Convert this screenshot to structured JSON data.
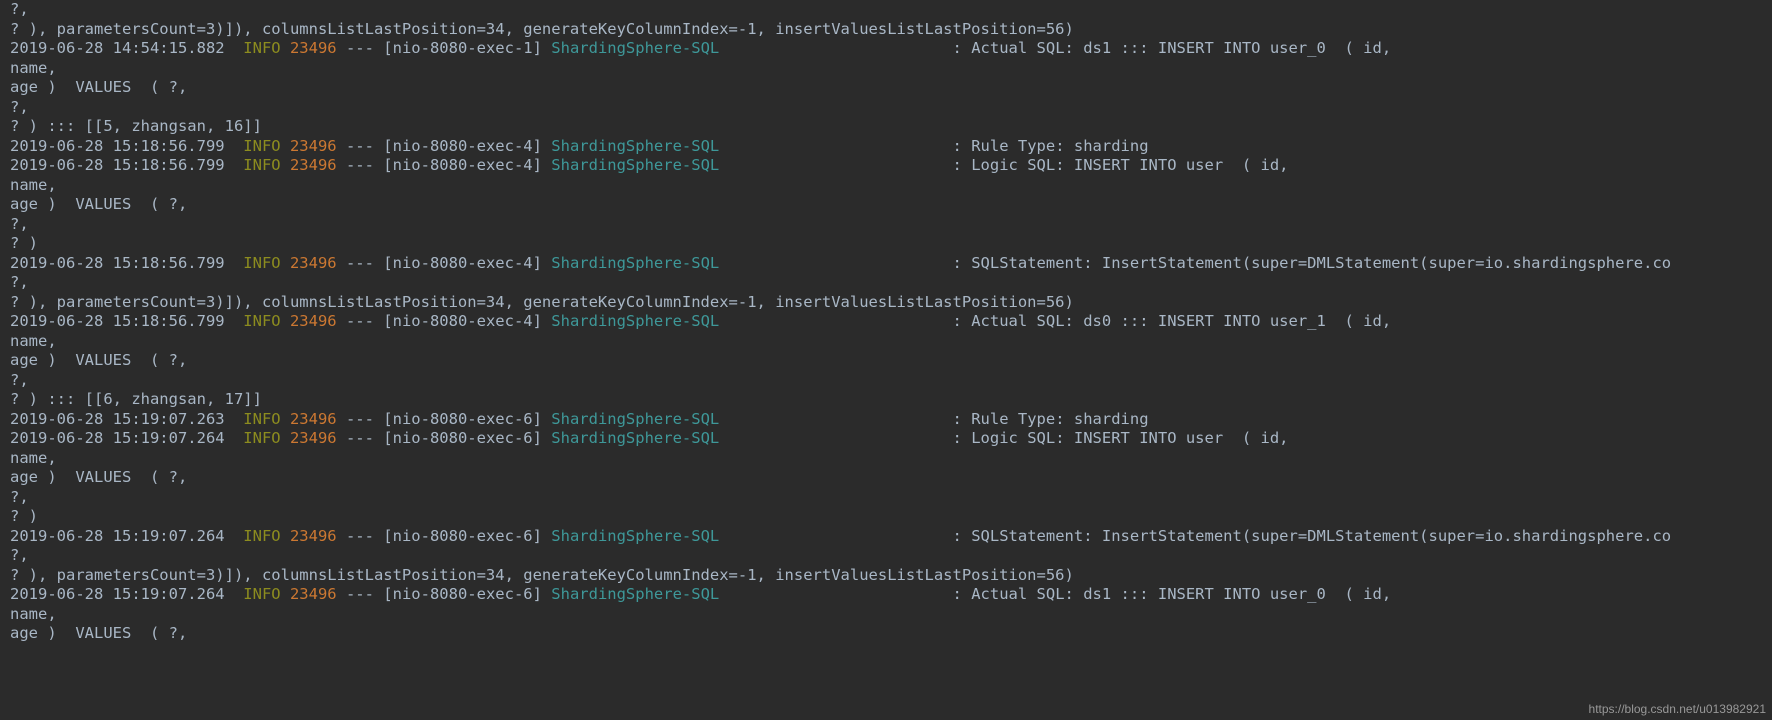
{
  "colors": {
    "bg": "#2b2b2b",
    "text": "#a9b7c6",
    "level": "#8c8c1f",
    "pid": "#cc7832",
    "logger": "#3e9899"
  },
  "watermark": "https://blog.csdn.net/u013982921",
  "lines": [
    {
      "segments": [
        {
          "t": "text",
          "v": "?,"
        }
      ]
    },
    {
      "segments": [
        {
          "t": "text",
          "v": "? ), parametersCount=3)]), columnsListLastPosition=34, generateKeyColumnIndex=-1, insertValuesListLastPosition=56)"
        }
      ]
    },
    {
      "segments": [
        {
          "t": "text",
          "v": "2019-06-28 14:54:15.882  "
        },
        {
          "t": "info",
          "v": "INFO"
        },
        {
          "t": "text",
          "v": " "
        },
        {
          "t": "pid",
          "v": "23496"
        },
        {
          "t": "text",
          "v": " --- [nio-8080-exec-1] "
        },
        {
          "t": "logger",
          "v": "ShardingSphere-SQL"
        },
        {
          "t": "text",
          "v": "                         : Actual SQL: ds1 ::: INSERT INTO user_0  ( id,"
        }
      ]
    },
    {
      "segments": [
        {
          "t": "text",
          "v": "name,"
        }
      ]
    },
    {
      "segments": [
        {
          "t": "text",
          "v": "age )  VALUES  ( ?,"
        }
      ]
    },
    {
      "segments": [
        {
          "t": "text",
          "v": "?,"
        }
      ]
    },
    {
      "segments": [
        {
          "t": "text",
          "v": "? ) ::: [[5, zhangsan, 16]]"
        }
      ]
    },
    {
      "segments": [
        {
          "t": "text",
          "v": "2019-06-28 15:18:56.799  "
        },
        {
          "t": "info",
          "v": "INFO"
        },
        {
          "t": "text",
          "v": " "
        },
        {
          "t": "pid",
          "v": "23496"
        },
        {
          "t": "text",
          "v": " --- [nio-8080-exec-4] "
        },
        {
          "t": "logger",
          "v": "ShardingSphere-SQL"
        },
        {
          "t": "text",
          "v": "                         : Rule Type: sharding"
        }
      ]
    },
    {
      "segments": [
        {
          "t": "text",
          "v": "2019-06-28 15:18:56.799  "
        },
        {
          "t": "info",
          "v": "INFO"
        },
        {
          "t": "text",
          "v": " "
        },
        {
          "t": "pid",
          "v": "23496"
        },
        {
          "t": "text",
          "v": " --- [nio-8080-exec-4] "
        },
        {
          "t": "logger",
          "v": "ShardingSphere-SQL"
        },
        {
          "t": "text",
          "v": "                         : Logic SQL: INSERT INTO user  ( id,"
        }
      ]
    },
    {
      "segments": [
        {
          "t": "text",
          "v": "name,"
        }
      ]
    },
    {
      "segments": [
        {
          "t": "text",
          "v": "age )  VALUES  ( ?,"
        }
      ]
    },
    {
      "segments": [
        {
          "t": "text",
          "v": "?,"
        }
      ]
    },
    {
      "segments": [
        {
          "t": "text",
          "v": "? )"
        }
      ]
    },
    {
      "segments": [
        {
          "t": "text",
          "v": "2019-06-28 15:18:56.799  "
        },
        {
          "t": "info",
          "v": "INFO"
        },
        {
          "t": "text",
          "v": " "
        },
        {
          "t": "pid",
          "v": "23496"
        },
        {
          "t": "text",
          "v": " --- [nio-8080-exec-4] "
        },
        {
          "t": "logger",
          "v": "ShardingSphere-SQL"
        },
        {
          "t": "text",
          "v": "                         : SQLStatement: InsertStatement(super=DMLStatement(super=io.shardingsphere.co"
        }
      ]
    },
    {
      "segments": [
        {
          "t": "text",
          "v": "?,"
        }
      ]
    },
    {
      "segments": [
        {
          "t": "text",
          "v": "? ), parametersCount=3)]), columnsListLastPosition=34, generateKeyColumnIndex=-1, insertValuesListLastPosition=56)"
        }
      ]
    },
    {
      "segments": [
        {
          "t": "text",
          "v": "2019-06-28 15:18:56.799  "
        },
        {
          "t": "info",
          "v": "INFO"
        },
        {
          "t": "text",
          "v": " "
        },
        {
          "t": "pid",
          "v": "23496"
        },
        {
          "t": "text",
          "v": " --- [nio-8080-exec-4] "
        },
        {
          "t": "logger",
          "v": "ShardingSphere-SQL"
        },
        {
          "t": "text",
          "v": "                         : Actual SQL: ds0 ::: INSERT INTO user_1  ( id,"
        }
      ]
    },
    {
      "segments": [
        {
          "t": "text",
          "v": "name,"
        }
      ]
    },
    {
      "segments": [
        {
          "t": "text",
          "v": "age )  VALUES  ( ?,"
        }
      ]
    },
    {
      "segments": [
        {
          "t": "text",
          "v": "?,"
        }
      ]
    },
    {
      "segments": [
        {
          "t": "text",
          "v": "? ) ::: [[6, zhangsan, 17]]"
        }
      ]
    },
    {
      "segments": [
        {
          "t": "text",
          "v": "2019-06-28 15:19:07.263  "
        },
        {
          "t": "info",
          "v": "INFO"
        },
        {
          "t": "text",
          "v": " "
        },
        {
          "t": "pid",
          "v": "23496"
        },
        {
          "t": "text",
          "v": " --- [nio-8080-exec-6] "
        },
        {
          "t": "logger",
          "v": "ShardingSphere-SQL"
        },
        {
          "t": "text",
          "v": "                         : Rule Type: sharding"
        }
      ]
    },
    {
      "segments": [
        {
          "t": "text",
          "v": "2019-06-28 15:19:07.264  "
        },
        {
          "t": "info",
          "v": "INFO"
        },
        {
          "t": "text",
          "v": " "
        },
        {
          "t": "pid",
          "v": "23496"
        },
        {
          "t": "text",
          "v": " --- [nio-8080-exec-6] "
        },
        {
          "t": "logger",
          "v": "ShardingSphere-SQL"
        },
        {
          "t": "text",
          "v": "                         : Logic SQL: INSERT INTO user  ( id,"
        }
      ]
    },
    {
      "segments": [
        {
          "t": "text",
          "v": "name,"
        }
      ]
    },
    {
      "segments": [
        {
          "t": "text",
          "v": "age )  VALUES  ( ?,"
        }
      ]
    },
    {
      "segments": [
        {
          "t": "text",
          "v": "?,"
        }
      ]
    },
    {
      "segments": [
        {
          "t": "text",
          "v": "? )"
        }
      ]
    },
    {
      "segments": [
        {
          "t": "text",
          "v": "2019-06-28 15:19:07.264  "
        },
        {
          "t": "info",
          "v": "INFO"
        },
        {
          "t": "text",
          "v": " "
        },
        {
          "t": "pid",
          "v": "23496"
        },
        {
          "t": "text",
          "v": " --- [nio-8080-exec-6] "
        },
        {
          "t": "logger",
          "v": "ShardingSphere-SQL"
        },
        {
          "t": "text",
          "v": "                         : SQLStatement: InsertStatement(super=DMLStatement(super=io.shardingsphere.co"
        }
      ]
    },
    {
      "segments": [
        {
          "t": "text",
          "v": "?,"
        }
      ]
    },
    {
      "segments": [
        {
          "t": "text",
          "v": "? ), parametersCount=3)]), columnsListLastPosition=34, generateKeyColumnIndex=-1, insertValuesListLastPosition=56)"
        }
      ]
    },
    {
      "segments": [
        {
          "t": "text",
          "v": "2019-06-28 15:19:07.264  "
        },
        {
          "t": "info",
          "v": "INFO"
        },
        {
          "t": "text",
          "v": " "
        },
        {
          "t": "pid",
          "v": "23496"
        },
        {
          "t": "text",
          "v": " --- [nio-8080-exec-6] "
        },
        {
          "t": "logger",
          "v": "ShardingSphere-SQL"
        },
        {
          "t": "text",
          "v": "                         : Actual SQL: ds1 ::: INSERT INTO user_0  ( id,"
        }
      ]
    },
    {
      "segments": [
        {
          "t": "text",
          "v": "name,"
        }
      ]
    },
    {
      "segments": [
        {
          "t": "text",
          "v": "age )  VALUES  ( ?,"
        }
      ]
    }
  ]
}
